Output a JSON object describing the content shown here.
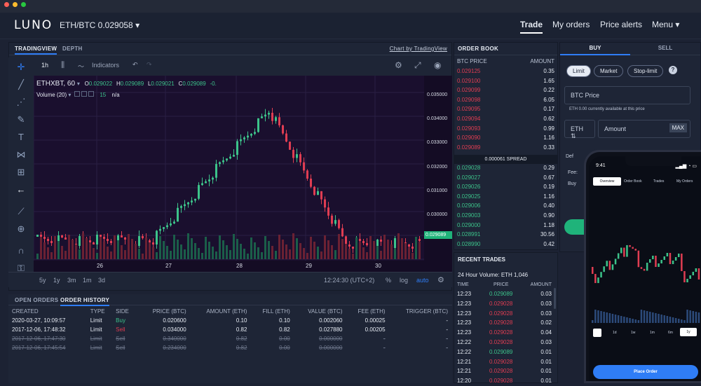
{
  "header": {
    "logo": "LUNO",
    "pair": "ETH/BTC 0.029058",
    "pair_caret": "▾",
    "nav": [
      "Trade",
      "My orders",
      "Price alerts",
      "Menu ▾"
    ]
  },
  "chart_panel": {
    "tabs": [
      "TRADINGVIEW",
      "DEPTH"
    ],
    "chart_link": "Chart by TradingView",
    "interval": "1h",
    "indicators": "Indicators",
    "symbol": "ETHXBT, 60",
    "ohlc": {
      "o": "0.029022",
      "h": "0.029089",
      "l": "0.029021",
      "c": "0.029089",
      "chg": "-0."
    },
    "volume": "Volume (20)",
    "volume_vals": [
      "15",
      "n/a"
    ],
    "y_ticks": [
      "0.035000",
      "0.034000",
      "0.033000",
      "0.032000",
      "0.031000",
      "0.030000"
    ],
    "last_price": "0.029089",
    "x_ticks": [
      "26",
      "27",
      "28",
      "29",
      "30"
    ],
    "ranges": [
      "5y",
      "1y",
      "3m",
      "1m",
      "3d"
    ],
    "time": "12:24:30 (UTC+2)",
    "scale_opts": [
      "%",
      "log",
      "auto"
    ]
  },
  "order_book": {
    "title": "ORDER BOOK",
    "col_price": "BTC PRICE",
    "col_amount": "AMOUNT",
    "asks": [
      [
        "0.029125",
        "0.35"
      ],
      [
        "0.029100",
        "1.65"
      ],
      [
        "0.029099",
        "0.22"
      ],
      [
        "0.029098",
        "6.05"
      ],
      [
        "0.029095",
        "0.17"
      ],
      [
        "0.029094",
        "0.62"
      ],
      [
        "0.029093",
        "0.99"
      ],
      [
        "0.029090",
        "1.16"
      ],
      [
        "0.029089",
        "0.33"
      ]
    ],
    "spread": "0.000061 SPREAD",
    "bids": [
      [
        "0.029028",
        "0.29"
      ],
      [
        "0.029027",
        "0.67"
      ],
      [
        "0.029026",
        "0.19"
      ],
      [
        "0.029025",
        "1.16"
      ],
      [
        "0.029006",
        "0.40"
      ],
      [
        "0.029003",
        "0.90"
      ],
      [
        "0.029000",
        "1.18"
      ],
      [
        "0.028991",
        "30.56"
      ],
      [
        "0.028990",
        "0.42"
      ]
    ]
  },
  "recent_trades": {
    "title": "RECENT TRADES",
    "volume": "24 Hour Volume: ETH 1,046",
    "cols": [
      "TIME",
      "PRICE",
      "AMOUNT"
    ],
    "rows": [
      [
        "12:23",
        "0.029089",
        "0.03",
        "g"
      ],
      [
        "12:23",
        "0.029028",
        "0.03",
        "r"
      ],
      [
        "12:23",
        "0.029028",
        "0.03",
        "r"
      ],
      [
        "12:23",
        "0.029028",
        "0.02",
        "r"
      ],
      [
        "12:23",
        "0.029028",
        "0.04",
        "r"
      ],
      [
        "12:22",
        "0.029028",
        "0.03",
        "r"
      ],
      [
        "12:22",
        "0.029089",
        "0.01",
        "g"
      ],
      [
        "12:21",
        "0.029028",
        "0.01",
        "r"
      ],
      [
        "12:21",
        "0.029028",
        "0.01",
        "r"
      ],
      [
        "12:20",
        "0.029028",
        "0.01",
        "r"
      ]
    ]
  },
  "trade_form": {
    "tabs": [
      "BUY",
      "SELL"
    ],
    "types": [
      "Limit",
      "Market",
      "Stop-limit"
    ],
    "help": "?",
    "price_placeholder": "BTC  Price",
    "avail": "ETH 0.00 currently available at this price",
    "currency": "ETH ⇅",
    "amount_placeholder": "Amount",
    "max": "MAX",
    "hidden_1": "Def",
    "hidden_2": "Fee:",
    "hidden_3": "Buy"
  },
  "orders": {
    "tabs": [
      "OPEN ORDERS",
      "ORDER HISTORY"
    ],
    "cols": [
      "CREATED",
      "TYPE",
      "SIDE",
      "PRICE (BTC)",
      "AMOUNT (ETH)",
      "FILL (ETH)",
      "VALUE (BTC)",
      "FEE (ETH)",
      "TRIGGER (BTC)"
    ],
    "rows": [
      [
        "2020-03-27, 10:09:57",
        "Limit",
        "Buy",
        "0.020600",
        "0.10",
        "0.10",
        "0.002060",
        "0.00025",
        "-"
      ],
      [
        "2017-12-06, 17:48:32",
        "Limit",
        "Sell",
        "0.034000",
        "0.82",
        "0.82",
        "0.027880",
        "0.00205",
        "-"
      ],
      [
        "2017-12-06, 17:47:30",
        "Limit",
        "Sell",
        "0.340000",
        "0.82",
        "0.00",
        "0.000000",
        "-",
        "-"
      ],
      [
        "2017-12-06, 17:45:54",
        "Limit",
        "Sell",
        "0.234000",
        "0.82",
        "0.00",
        "0.000000",
        "-",
        "-"
      ]
    ]
  },
  "phone": {
    "time": "9:41",
    "tabs": [
      "Overview",
      "Order Book",
      "Trades",
      "My Orders"
    ],
    "ranges": [
      "1d",
      "1w",
      "1m",
      "6m",
      "1y"
    ],
    "button": "Place Order"
  },
  "colors": {
    "up": "#3cc38a",
    "down": "#e03d52",
    "accent": "#2f7df6"
  }
}
